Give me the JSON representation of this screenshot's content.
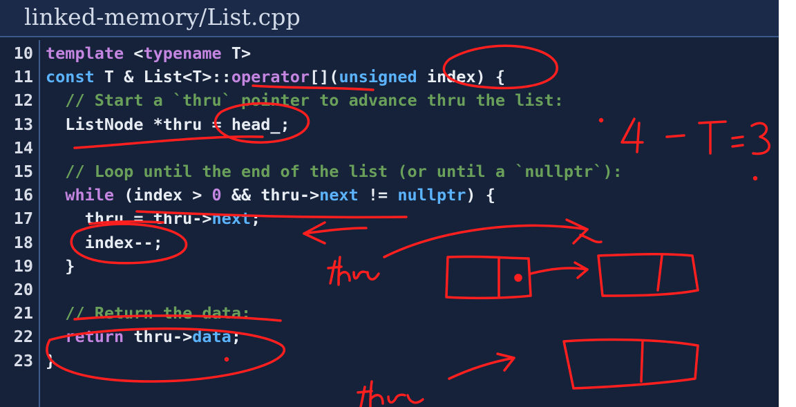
{
  "title": "linked-memory/List.cpp",
  "code_lines": [
    {
      "number": "10",
      "tokens": [
        {
          "text": "template ",
          "kind": "keyword"
        },
        {
          "text": "<",
          "kind": "plain"
        },
        {
          "text": "typename",
          "kind": "keyword"
        },
        {
          "text": " T>",
          "kind": "plain"
        }
      ]
    },
    {
      "number": "11",
      "tokens": [
        {
          "text": "const",
          "kind": "type"
        },
        {
          "text": " T & List<T>::",
          "kind": "plain"
        },
        {
          "text": "operator",
          "kind": "keyword"
        },
        {
          "text": "[](",
          "kind": "plain"
        },
        {
          "text": "unsigned",
          "kind": "type"
        },
        {
          "text": " index) {",
          "kind": "plain"
        }
      ]
    },
    {
      "number": "12",
      "tokens": [
        {
          "text": "  // Start a `thru` pointer to advance thru the list:",
          "kind": "comment"
        }
      ]
    },
    {
      "number": "13",
      "tokens": [
        {
          "text": "  ListNode *thru = head_;",
          "kind": "plain"
        }
      ]
    },
    {
      "number": "14",
      "tokens": []
    },
    {
      "number": "15",
      "tokens": [
        {
          "text": "  // Loop until the end of the list (or until a `nullptr`):",
          "kind": "comment"
        }
      ]
    },
    {
      "number": "16",
      "tokens": [
        {
          "text": "  ",
          "kind": "plain"
        },
        {
          "text": "while",
          "kind": "keyword"
        },
        {
          "text": " (index > ",
          "kind": "plain"
        },
        {
          "text": "0",
          "kind": "number"
        },
        {
          "text": " && thru->",
          "kind": "plain"
        },
        {
          "text": "next",
          "kind": "type"
        },
        {
          "text": " != ",
          "kind": "plain"
        },
        {
          "text": "nullptr",
          "kind": "type"
        },
        {
          "text": ") {",
          "kind": "plain"
        }
      ]
    },
    {
      "number": "17",
      "tokens": [
        {
          "text": "    thru = thru->",
          "kind": "plain"
        },
        {
          "text": "next",
          "kind": "type"
        },
        {
          "text": ";",
          "kind": "plain"
        }
      ]
    },
    {
      "number": "18",
      "tokens": [
        {
          "text": "    index--;",
          "kind": "plain"
        }
      ]
    },
    {
      "number": "19",
      "tokens": [
        {
          "text": "  }",
          "kind": "plain"
        }
      ]
    },
    {
      "number": "20",
      "tokens": []
    },
    {
      "number": "21",
      "tokens": [
        {
          "text": "  // Return the data:",
          "kind": "comment"
        }
      ]
    },
    {
      "number": "22",
      "tokens": [
        {
          "text": "  ",
          "kind": "plain"
        },
        {
          "text": "return",
          "kind": "keyword"
        },
        {
          "text": " thru->",
          "kind": "plain"
        },
        {
          "text": "data",
          "kind": "type"
        },
        {
          "text": ";",
          "kind": "plain"
        }
      ]
    },
    {
      "number": "23",
      "tokens": [
        {
          "text": "}",
          "kind": "plain"
        }
      ]
    }
  ],
  "colors": {
    "background": "#15223a",
    "keyword": "#c486e0",
    "type": "#5cb4ff",
    "comment": "#6aa05a",
    "plain": "#e8ecf3",
    "annotation": "#ff1f1f"
  }
}
